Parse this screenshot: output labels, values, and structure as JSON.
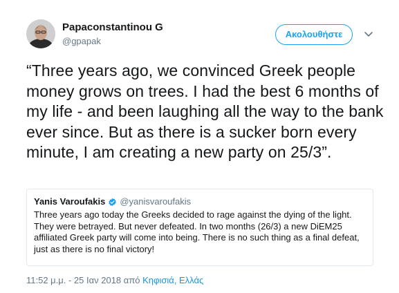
{
  "author": {
    "name": "Papaconstantinou G",
    "handle": "@gpapak"
  },
  "actions": {
    "follow_label": "Ακολουθήστε",
    "more_icon": "chevron-down-icon"
  },
  "tweet": {
    "text": "“Three years ago, we convinced Greek people money grows on trees. I had the best 6 months of my life - and been laughing all the way to the bank ever since. But as there is a sucker born every minute, I am creating a new party on 25/3”."
  },
  "quoted_tweet": {
    "name": "Yanis Varoufakis",
    "verified_icon": "verified-badge-icon",
    "handle": "@yanisvaroufakis",
    "text": "Three years ago today the Greeks decided to rage against the dying of the light. They were betrayed. But never defeated. In two months (26/3) a new DiEM25 affiliated Greek party will come into being. There is no such thing as a final defeat, just as there is no final victory!"
  },
  "meta": {
    "timestamp": "11:52 μ.μ. - 25 Ιαν 2018",
    "from_word": "από",
    "location": "Κηφισιά, Ελλάς"
  },
  "colors": {
    "accent": "#1da1f2",
    "link": "#1b95e0",
    "secondary_text": "#657786",
    "border": "#e1e8ed"
  }
}
